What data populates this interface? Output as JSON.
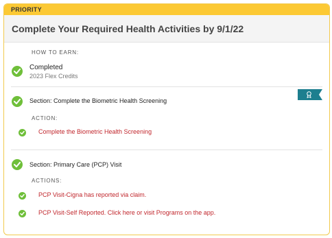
{
  "banner": {
    "label": "PRIORITY"
  },
  "header": {
    "title": "Complete Your Required Health Activities by 9/1/22"
  },
  "how_to_earn": {
    "label": "HOW TO EARN:",
    "status_title": "Completed",
    "status_sub": "2023 Flex Credits",
    "badge_icon": "award-ribbon-icon"
  },
  "sections": [
    {
      "title": "Section: Complete the Biometric Health Screening",
      "action_label": "ACTION:",
      "actions": [
        "Complete the Biometric Health Screening"
      ]
    },
    {
      "title": "Section: Primary Care (PCP) Visit",
      "action_label": "ACTIONS:",
      "actions": [
        "PCP Visit-Cigna has reported via claim.",
        "PCP Visit-Self Reported. Click here or visit Programs on the app."
      ]
    }
  ],
  "colors": {
    "banner": "#fcc934",
    "check": "#6fbf3a",
    "link": "#c1272d",
    "ribbon": "#1d7f8f"
  }
}
